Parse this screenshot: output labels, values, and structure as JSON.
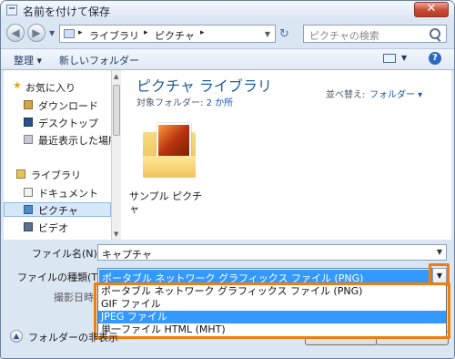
{
  "window": {
    "title": "名前を付けて保存",
    "close_label": "✕"
  },
  "address": {
    "crumbs": [
      "ライブラリ",
      "ピクチャ"
    ],
    "search_placeholder": "ピクチャの検索"
  },
  "toolbar": {
    "organize": "整理 ▾",
    "new_folder": "新しいフォルダー",
    "help": "?"
  },
  "nav": {
    "favorites": "お気に入り",
    "downloads": "ダウンロード",
    "desktop": "デスクトップ",
    "recent": "最近表示した場所",
    "libraries": "ライブラリ",
    "documents": "ドキュメント",
    "pictures": "ピクチャ",
    "videos": "ビデオ"
  },
  "library": {
    "title": "ピクチャ ライブラリ",
    "target_label": "対象フォルダー:",
    "target_value": "2 か所",
    "sort_label": "並べ替え:",
    "sort_value": "フォルダー ▾"
  },
  "files": [
    {
      "name": "サンプル ピクチャ"
    }
  ],
  "form": {
    "filename_label": "ファイル名(N):",
    "filename_value": "キャプチャ",
    "type_label": "ファイルの種類(T):",
    "type_value": "ポータブル ネットワーク グラフィックス ファイル (PNG)",
    "date_label": "撮影日時:",
    "type_options": [
      "ポータブル ネットワーク グラフィックス ファイル (PNG)",
      "GIF ファイル",
      "JPEG ファイル",
      "単一ファイル HTML (MHT)"
    ],
    "selected_option_index": 2,
    "hide_folders": "フォルダーの非表示"
  },
  "colors": {
    "highlight": "#f07d10",
    "selection": "#3399ff",
    "library_title": "#1e5d9a"
  }
}
